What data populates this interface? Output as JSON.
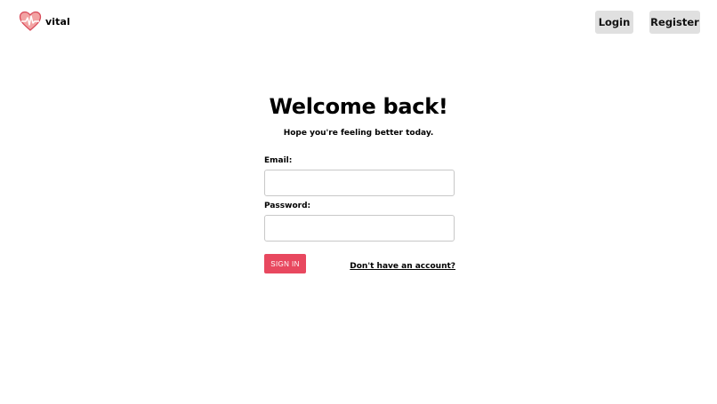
{
  "header": {
    "brand": "vital",
    "logo_icon": "heart-pulse-icon",
    "login_label": "Login",
    "register_label": "Register"
  },
  "main": {
    "title": "Welcome back!",
    "subtitle": "Hope you're feeling better today.",
    "email_label": "Email:",
    "email_value": "",
    "password_label": "Password:",
    "password_value": "",
    "signin_label": "SIGN IN",
    "signup_link": "Don't have an account?"
  },
  "colors": {
    "accent": "#e8485f",
    "logo_heart": "#e88a8a",
    "nav_button_bg": "#e0e0e0"
  }
}
